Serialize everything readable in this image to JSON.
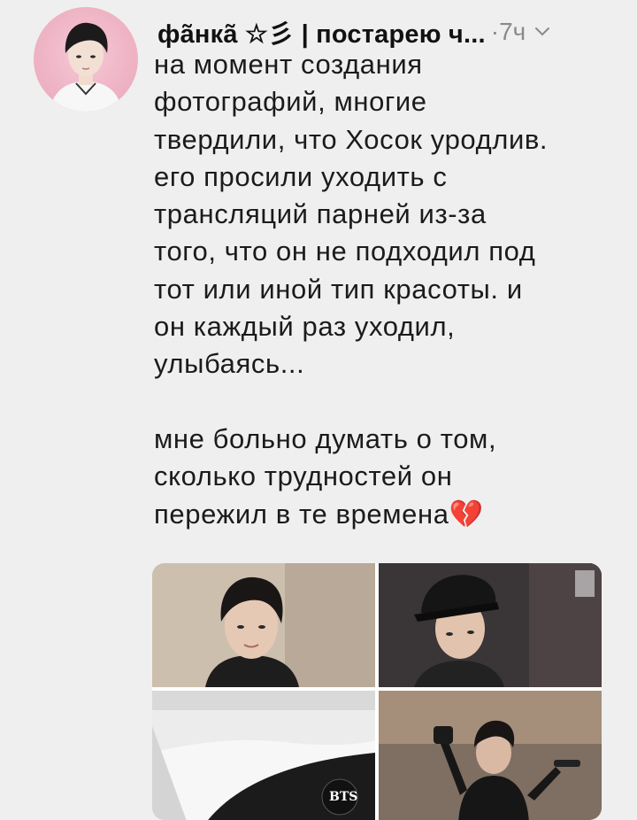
{
  "tweet": {
    "display_name": "фãнкã ☆彡 | постарею ч...",
    "separator": "·",
    "time": "7ч",
    "text": "на момент создания\nфотографий, многие\nтвердили, что Хосок уродлив.\nего просили уходить с\nтрансляций парней из-за\nтого, что он не подходил под\nтот или иной тип красоты. и\nон каждый раз уходил,\nулыбаясь...\n\nмне больно думать о том,\nсколько трудностей он\nпережил в те времена💔",
    "media": [
      {
        "label": "photo-1"
      },
      {
        "label": "photo-2"
      },
      {
        "label": "photo-3",
        "logo_text": "BTS"
      },
      {
        "label": "photo-4"
      }
    ]
  },
  "colors": {
    "background": "#efefef",
    "text": "#1b1b1b",
    "muted": "#8a8a8a",
    "avatar_bg": "#eeb3c4"
  }
}
